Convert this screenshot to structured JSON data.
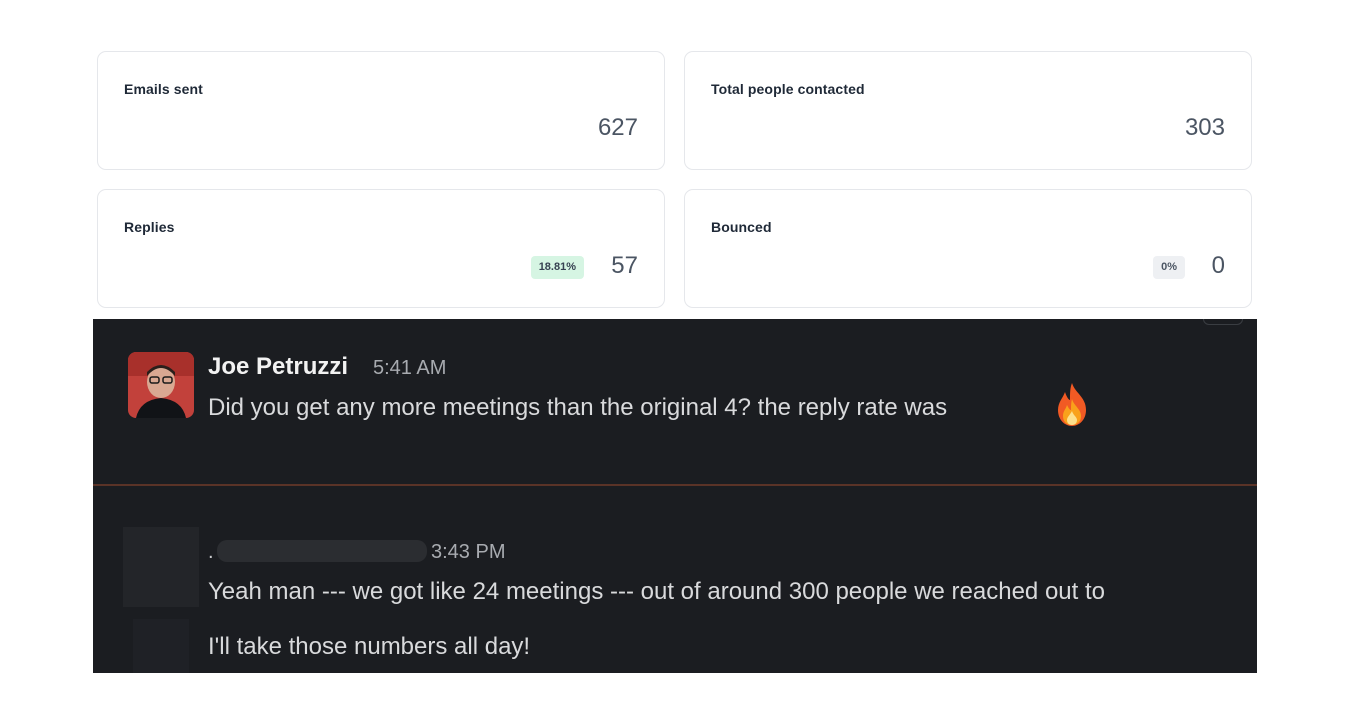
{
  "stats": {
    "emails_sent": {
      "label": "Emails sent",
      "value": "627"
    },
    "total_people": {
      "label": "Total people contacted",
      "value": "303"
    },
    "replies": {
      "label": "Replies",
      "value": "57",
      "badge": "18.81%"
    },
    "bounced": {
      "label": "Bounced",
      "value": "0",
      "badge": "0%"
    }
  },
  "colors": {
    "reply_badge_bg": "#d6f5e3",
    "bounced_badge_bg": "#eef0f3",
    "chat_bg": "#1b1d21",
    "divider": "#5a3327"
  },
  "chat": {
    "message1": {
      "author": "Joe Petruzzi",
      "time": "5:41 AM",
      "text": "Did you get any more meetings than the original 4? the reply rate was",
      "emoji": "fire-emoji"
    },
    "message2": {
      "author_prefix": ".",
      "time": "3:43 PM",
      "text": "Yeah man --- we got like 24 meetings --- out of around 300 people we reached out to"
    },
    "message3": {
      "text": "I'll take those numbers all day!"
    }
  }
}
